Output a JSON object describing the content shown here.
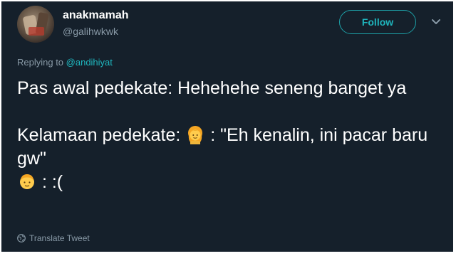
{
  "user": {
    "display_name": "anakmamah",
    "handle": "@galihwkwk"
  },
  "follow_label": "Follow",
  "reply": {
    "prefix": "Replying to ",
    "mention": "@andihiyat"
  },
  "tweet": {
    "line1": "Pas awal pedekate: Hehehehe seneng banget ya",
    "line2_prefix": "Kelamaan pedekate: ",
    "line2_quote": " : \"Eh kenalin, ini pacar baru gw\"",
    "line3_text": " : :(",
    "emoji_1": "girl-face-icon",
    "emoji_2": "boy-face-icon"
  },
  "translate_label": "Translate Tweet",
  "colors": {
    "background": "#15202b",
    "accent": "#1fb5bd",
    "secondary_text": "#8899a6"
  }
}
